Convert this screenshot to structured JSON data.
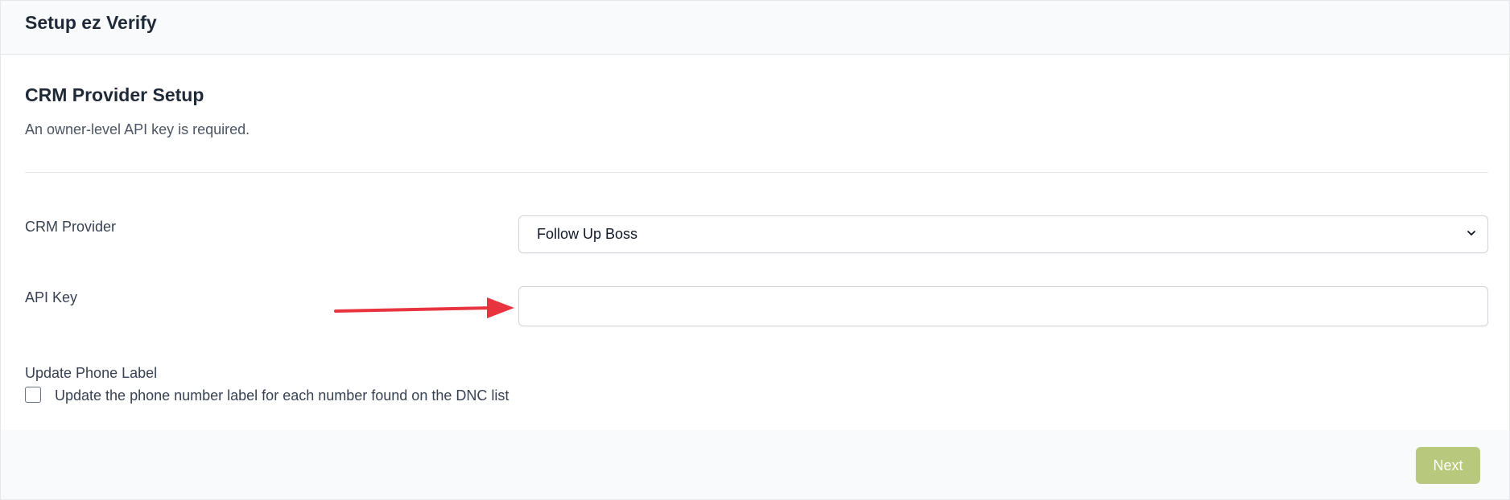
{
  "header": {
    "title": "Setup ez Verify"
  },
  "section": {
    "title": "CRM Provider Setup",
    "description": "An owner-level API key is required."
  },
  "form": {
    "crm_provider": {
      "label": "CRM Provider",
      "selected": "Follow Up Boss"
    },
    "api_key": {
      "label": "API Key",
      "value": ""
    },
    "update_phone_label": {
      "label": "Update Phone Label",
      "checkbox_label": "Update the phone number label for each number found on the DNC list"
    }
  },
  "footer": {
    "next_label": "Next"
  },
  "colors": {
    "arrow": "#e8343f",
    "next_button": "#b8c97d"
  },
  "icons": {
    "select_chevron": "chevron-down-icon",
    "annotation": "arrow-right-icon"
  }
}
